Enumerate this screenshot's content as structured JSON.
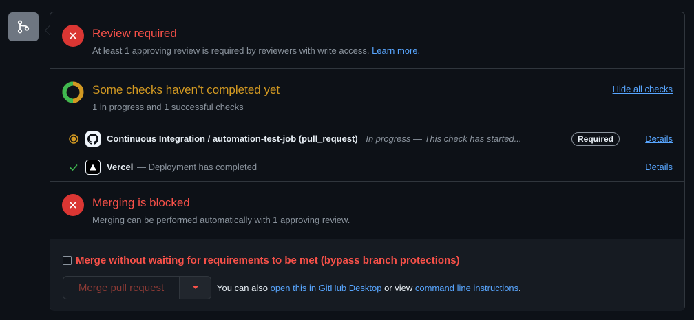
{
  "review": {
    "title": "Review required",
    "desc": "At least 1 approving review is required by reviewers with write access.",
    "learn_more": "Learn more."
  },
  "checks": {
    "title": "Some checks haven’t completed yet",
    "summary": "1 in progress and 1 successful checks",
    "hide_all": "Hide all checks",
    "items": [
      {
        "name": "Continuous Integration / automation-test-job (pull_request)",
        "status": "In progress — This check has started...",
        "badge": "Required",
        "details": "Details",
        "state_icon": "in-progress-dot-icon",
        "app_icon": "github-icon"
      },
      {
        "name": "Vercel",
        "status": "— Deployment has completed",
        "details": "Details",
        "state_icon": "check-icon",
        "app_icon": "vercel-icon"
      }
    ]
  },
  "blocked": {
    "title": "Merging is blocked",
    "desc": "Merging can be performed automatically with 1 approving review."
  },
  "merge": {
    "bypass_label": "Merge without waiting for requirements to be met (bypass branch protections)",
    "button_label": "Merge pull request",
    "also_prefix": "You can also ",
    "desktop_link": "open this in GitHub Desktop",
    "or_view": " or view ",
    "cli_link": "command line instructions",
    "period": "."
  },
  "colors": {
    "danger": "#f85149",
    "attention": "#d29922",
    "success": "#3fb950",
    "link": "#58a6ff",
    "background": "#0d1117",
    "border": "#30363d"
  }
}
